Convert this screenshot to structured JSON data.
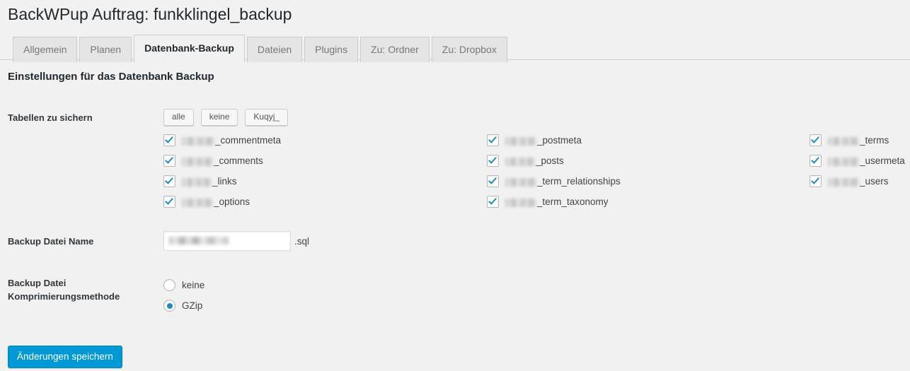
{
  "page": {
    "title": "BackWPup Auftrag: funkklingel_backup",
    "section_heading": "Einstellungen für das Datenbank Backup",
    "background_color": "#f1f1f1",
    "accent_color": "#0099d5",
    "control_accent_color": "#1e8cbe"
  },
  "tabs": [
    {
      "label": "Allgemein",
      "active": false
    },
    {
      "label": "Planen",
      "active": false
    },
    {
      "label": "Datenbank-Backup",
      "active": true
    },
    {
      "label": "Dateien",
      "active": false
    },
    {
      "label": "Plugins",
      "active": false
    },
    {
      "label": "Zu: Ordner",
      "active": false
    },
    {
      "label": "Zu: Dropbox",
      "active": false
    }
  ],
  "form": {
    "tables": {
      "label": "Tabellen zu sichern",
      "buttons": [
        {
          "label": "alle",
          "name": "select-all-button"
        },
        {
          "label": "keine",
          "name": "select-none-button"
        },
        {
          "label": "Kuqyj_",
          "name": "select-prefix-button"
        }
      ],
      "columns": [
        [
          {
            "prefix_redacted": true,
            "prefix_width": 46,
            "suffix": "_commentmeta",
            "checked": true
          },
          {
            "prefix_redacted": true,
            "prefix_width": 44,
            "suffix": "_comments",
            "checked": true
          },
          {
            "prefix_redacted": true,
            "prefix_width": 42,
            "suffix": "_links",
            "checked": true
          },
          {
            "prefix_redacted": true,
            "prefix_width": 44,
            "suffix": "_options",
            "checked": true
          }
        ],
        [
          {
            "prefix_redacted": true,
            "prefix_width": 44,
            "suffix": "_postmeta",
            "checked": true
          },
          {
            "prefix_redacted": true,
            "prefix_width": 42,
            "suffix": "_posts",
            "checked": true
          },
          {
            "prefix_redacted": true,
            "prefix_width": 44,
            "suffix": "_term_relationships",
            "checked": true
          },
          {
            "prefix_redacted": true,
            "prefix_width": 44,
            "suffix": "_term_taxonomy",
            "checked": true
          }
        ],
        [
          {
            "prefix_redacted": true,
            "prefix_width": 44,
            "suffix": "_terms",
            "checked": true
          },
          {
            "prefix_redacted": true,
            "prefix_width": 44,
            "suffix": "_usermeta",
            "checked": true
          },
          {
            "prefix_redacted": true,
            "prefix_width": 44,
            "suffix": "_users",
            "checked": true
          }
        ]
      ]
    },
    "filename": {
      "label": "Backup Datei Name",
      "value_redacted": true,
      "extension": ".sql"
    },
    "compression": {
      "label": "Backup Datei Komprimierungsmethode",
      "options": [
        {
          "label": "keine",
          "selected": false
        },
        {
          "label": "GZip",
          "selected": true
        }
      ]
    },
    "submit": {
      "label": "Änderungen speichern"
    }
  }
}
